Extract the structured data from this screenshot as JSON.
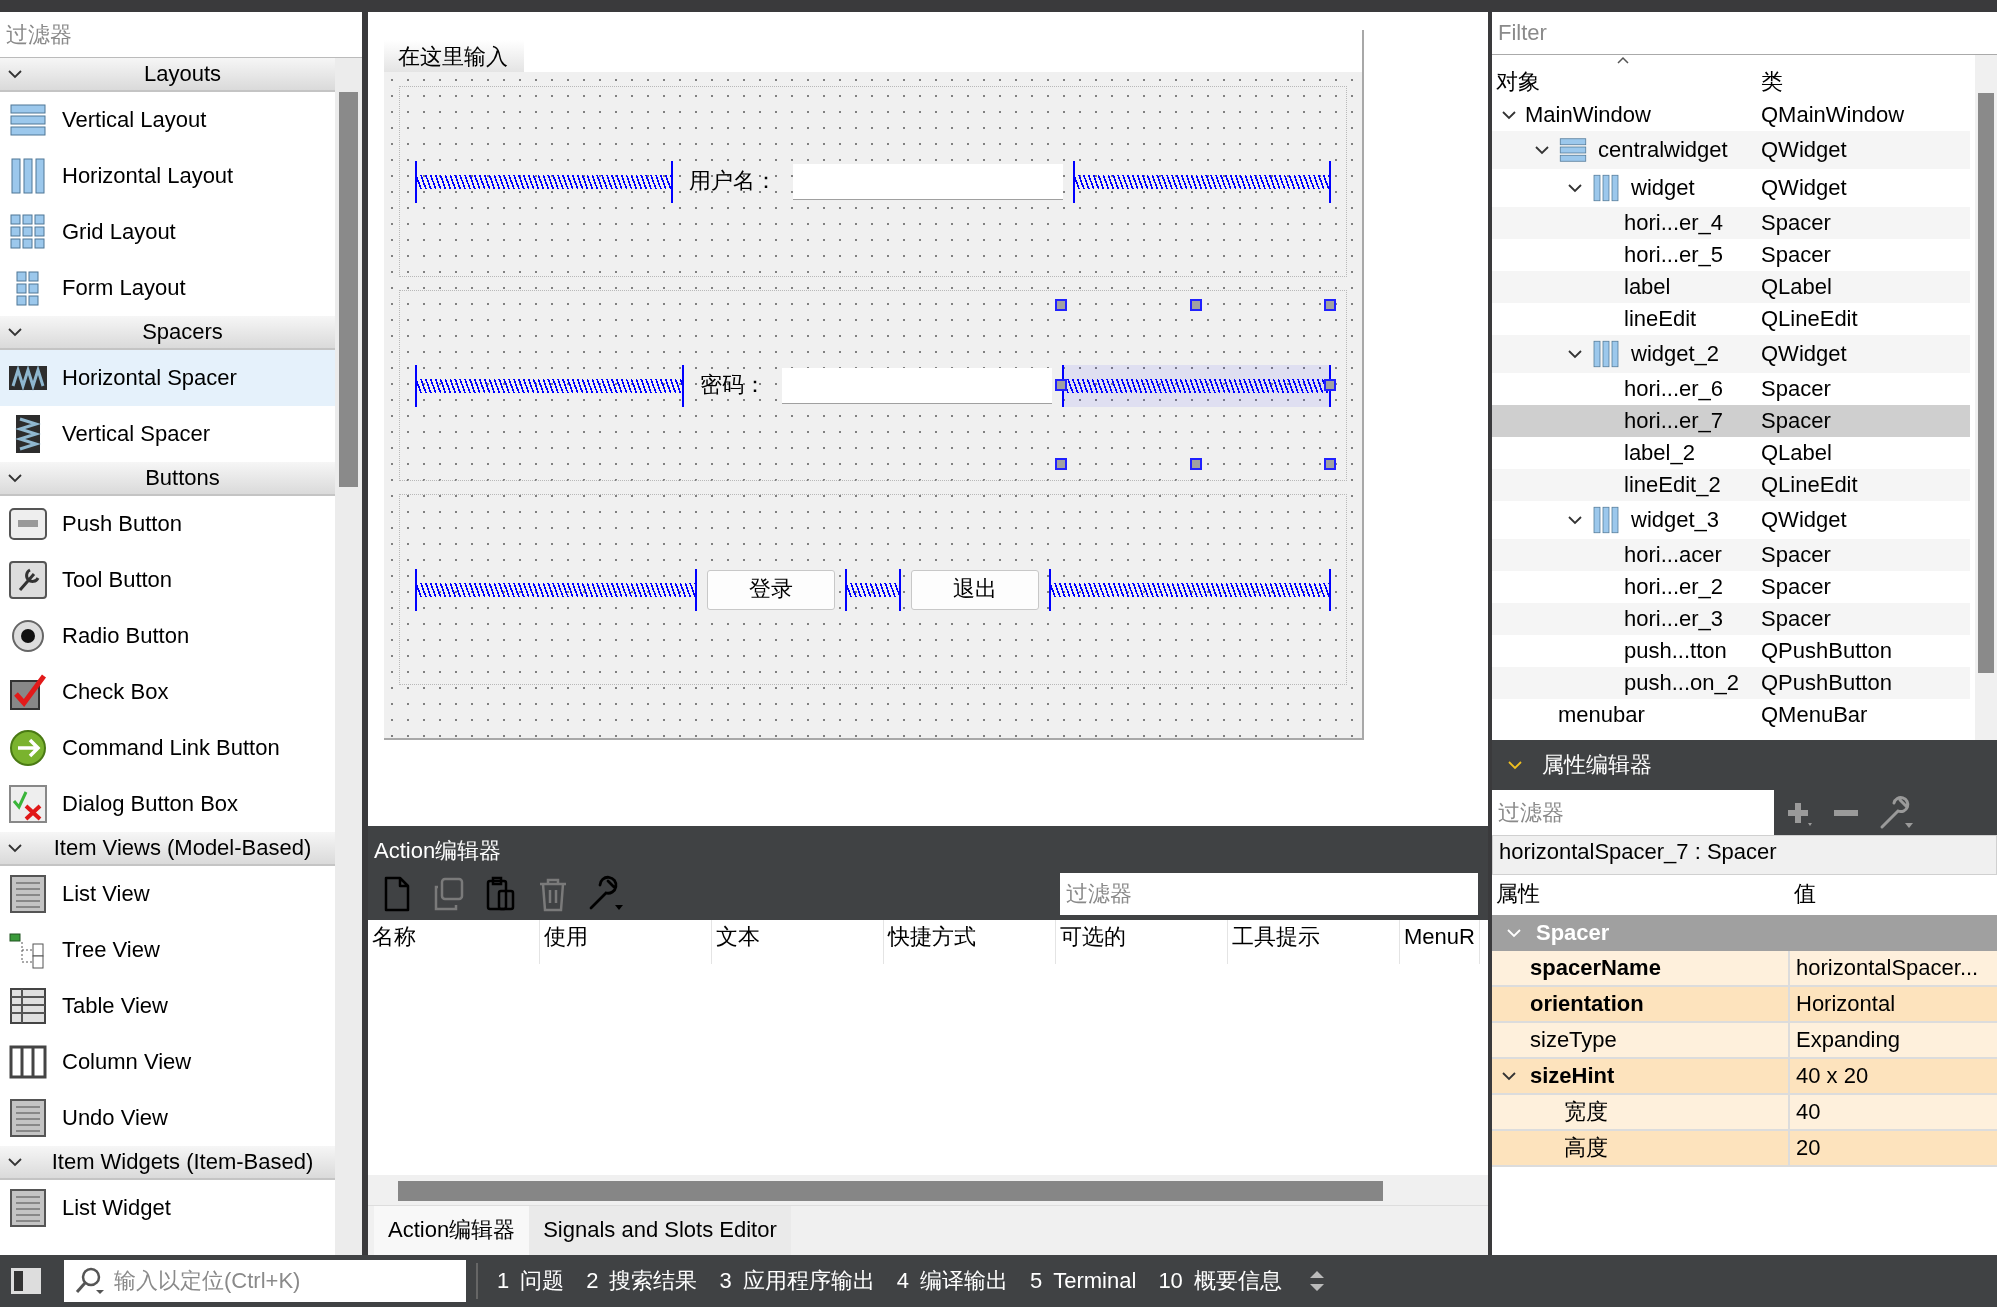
{
  "widget_box": {
    "filter_placeholder": "过滤器",
    "categories": [
      {
        "label": "Layouts",
        "expanded": true,
        "items": [
          {
            "label": "Vertical Layout",
            "selected": false
          },
          {
            "label": "Horizontal Layout",
            "selected": false
          },
          {
            "label": "Grid Layout",
            "selected": false
          },
          {
            "label": "Form Layout",
            "selected": false
          }
        ]
      },
      {
        "label": "Spacers",
        "expanded": true,
        "items": [
          {
            "label": "Horizontal Spacer",
            "selected": true
          },
          {
            "label": "Vertical Spacer",
            "selected": false
          }
        ]
      },
      {
        "label": "Buttons",
        "expanded": true,
        "items": [
          {
            "label": "Push Button",
            "selected": false
          },
          {
            "label": "Tool Button",
            "selected": false
          },
          {
            "label": "Radio Button",
            "selected": false
          },
          {
            "label": "Check Box",
            "selected": false
          },
          {
            "label": "Command Link Button",
            "selected": false
          },
          {
            "label": "Dialog Button Box",
            "selected": false
          }
        ]
      },
      {
        "label": "Item Views (Model-Based)",
        "expanded": true,
        "items": [
          {
            "label": "List View",
            "selected": false
          },
          {
            "label": "Tree View",
            "selected": false
          },
          {
            "label": "Table View",
            "selected": false
          },
          {
            "label": "Column View",
            "selected": false
          },
          {
            "label": "Undo View",
            "selected": false
          }
        ]
      },
      {
        "label": "Item Widgets (Item-Based)",
        "expanded": true,
        "items": [
          {
            "label": "List Widget",
            "selected": false
          }
        ]
      }
    ]
  },
  "form": {
    "menu_placeholder": "在这里输入",
    "layouts": [
      {
        "items": [
          {
            "kind": "spacer",
            "selected": false
          },
          {
            "kind": "label",
            "text": "用户名："
          },
          {
            "kind": "input"
          },
          {
            "kind": "spacer",
            "selected": false
          }
        ]
      },
      {
        "items": [
          {
            "kind": "spacer",
            "selected": false
          },
          {
            "kind": "label",
            "text": "密码："
          },
          {
            "kind": "input"
          },
          {
            "kind": "spacer",
            "selected": true
          }
        ]
      },
      {
        "items": [
          {
            "kind": "spacer",
            "selected": false
          },
          {
            "kind": "button",
            "text": "登录"
          },
          {
            "kind": "spacer",
            "selected": false
          },
          {
            "kind": "button",
            "text": "退出"
          },
          {
            "kind": "spacer",
            "selected": false
          }
        ]
      }
    ]
  },
  "action_editor": {
    "title": "Action编辑器",
    "toolbar": [
      {
        "kind": "new",
        "disabled": false
      },
      {
        "kind": "copy",
        "disabled": true
      },
      {
        "kind": "paste",
        "disabled": false
      },
      {
        "kind": "delete",
        "disabled": true
      },
      {
        "kind": "settings",
        "disabled": false
      }
    ],
    "filter_placeholder": "过滤器",
    "columns": [
      "名称",
      "使用",
      "文本",
      "快捷方式",
      "可选的",
      "工具提示",
      "MenuR"
    ],
    "tabs": [
      {
        "label": "Action编辑器",
        "selected": true
      },
      {
        "label": "Signals and Slots Editor",
        "selected": false
      }
    ]
  },
  "object_inspector": {
    "filter_placeholder": "Filter",
    "columns": [
      "对象",
      "类"
    ],
    "tree": [
      {
        "name": "MainWindow",
        "class": "QMainWindow",
        "kind": "plain",
        "expanded": true,
        "selected": false,
        "children": [
          {
            "name": "centralwidget",
            "class": "QWidget",
            "kind": "vbox",
            "expanded": true,
            "selected": false,
            "children": [
              {
                "name": "widget",
                "class": "QWidget",
                "kind": "hbox",
                "expanded": true,
                "selected": false,
                "children": [
                  {
                    "name": "hori...er_4",
                    "class": "Spacer",
                    "kind": "plain",
                    "selected": false
                  },
                  {
                    "name": "hori...er_5",
                    "class": "Spacer",
                    "kind": "plain",
                    "selected": false
                  },
                  {
                    "name": "label",
                    "class": "QLabel",
                    "kind": "plain",
                    "selected": false
                  },
                  {
                    "name": "lineEdit",
                    "class": "QLineEdit",
                    "kind": "plain",
                    "selected": false
                  }
                ]
              },
              {
                "name": "widget_2",
                "class": "QWidget",
                "kind": "hbox",
                "expanded": true,
                "selected": false,
                "children": [
                  {
                    "name": "hori...er_6",
                    "class": "Spacer",
                    "kind": "plain",
                    "selected": false
                  },
                  {
                    "name": "hori...er_7",
                    "class": "Spacer",
                    "kind": "plain",
                    "selected": true
                  },
                  {
                    "name": "label_2",
                    "class": "QLabel",
                    "kind": "plain",
                    "selected": false
                  },
                  {
                    "name": "lineEdit_2",
                    "class": "QLineEdit",
                    "kind": "plain",
                    "selected": false
                  }
                ]
              },
              {
                "name": "widget_3",
                "class": "QWidget",
                "kind": "hbox",
                "expanded": true,
                "selected": false,
                "children": [
                  {
                    "name": "hori...acer",
                    "class": "Spacer",
                    "kind": "plain",
                    "selected": false
                  },
                  {
                    "name": "hori...er_2",
                    "class": "Spacer",
                    "kind": "plain",
                    "selected": false
                  },
                  {
                    "name": "hori...er_3",
                    "class": "Spacer",
                    "kind": "plain",
                    "selected": false
                  },
                  {
                    "name": "push...tton",
                    "class": "QPushButton",
                    "kind": "plain",
                    "selected": false
                  },
                  {
                    "name": "push...on_2",
                    "class": "QPushButton",
                    "kind": "plain",
                    "selected": false
                  }
                ]
              }
            ]
          },
          {
            "name": "menubar",
            "class": "QMenuBar",
            "kind": "plain",
            "selected": false
          }
        ]
      }
    ]
  },
  "property_editor": {
    "title": "属性编辑器",
    "expanded": true,
    "filter_placeholder": "过滤器",
    "object": "horizontalSpacer_7 : Spacer",
    "columns": [
      "属性",
      "值"
    ],
    "groups": [
      {
        "label": "Spacer",
        "expanded": true,
        "properties": [
          {
            "name": "spacerName",
            "value": "horizontalSpacer...",
            "modified": true
          },
          {
            "name": "orientation",
            "value": "Horizontal",
            "modified": true
          },
          {
            "name": "sizeType",
            "value": "Expanding",
            "modified": false
          },
          {
            "name": "sizeHint",
            "value": "40 x 20",
            "modified": true,
            "expanded": true,
            "children": [
              {
                "name": "宽度",
                "value": "40",
                "modified": false
              },
              {
                "name": "高度",
                "value": "20",
                "modified": false
              }
            ]
          }
        ]
      }
    ]
  },
  "status_bar": {
    "locator_placeholder": "输入以定位(Ctrl+K)",
    "panes": [
      {
        "number": "1",
        "label": "问题"
      },
      {
        "number": "2",
        "label": "搜索结果"
      },
      {
        "number": "3",
        "label": "应用程序输出"
      },
      {
        "number": "4",
        "label": "编译输出"
      },
      {
        "number": "5",
        "label": "Terminal"
      },
      {
        "number": "10",
        "label": "概要信息"
      }
    ]
  }
}
